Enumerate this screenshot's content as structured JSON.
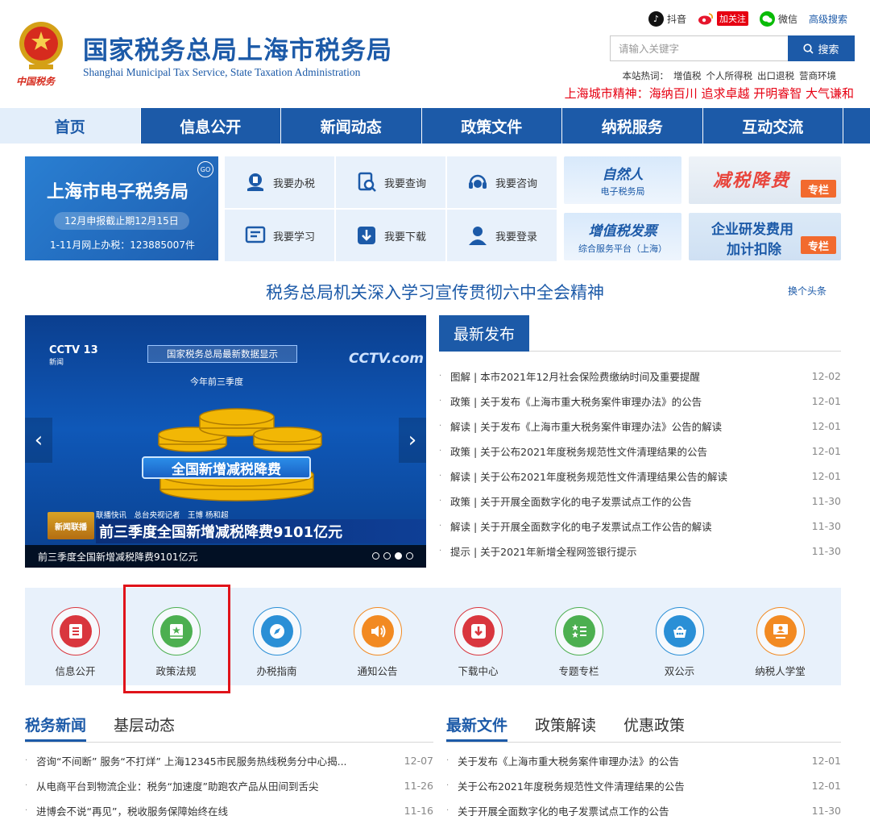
{
  "header": {
    "title": "国家税务总局上海市税务局",
    "subtitle": "Shanghai Municipal Tax Service, State Taxation Administration",
    "emblem_text": "中国税务",
    "top_links": {
      "douyin": "抖音",
      "weibo_follow": "加关注",
      "wechat": "微信",
      "advanced_search": "高级搜索"
    },
    "search": {
      "placeholder": "请输入关键字",
      "button": "搜索"
    },
    "hot_words_label": "本站热词：",
    "hot_words": [
      "增值税",
      "个人所得税",
      "出口退税",
      "营商环境"
    ],
    "spirit_label": "上海城市精神：",
    "spirit_text": "海纳百川 追求卓越 开明睿智 大气谦和"
  },
  "nav": [
    "首页",
    "信息公开",
    "新闻动态",
    "政策文件",
    "纳税服务",
    "互动交流"
  ],
  "etax": {
    "title": "上海市电子税务局",
    "go_label": "GO",
    "deadline": "12月申报截止期12月15日",
    "count": "1-11月网上办税：123885007件"
  },
  "actions": [
    "我要办税",
    "我要查询",
    "我要咨询",
    "我要学习",
    "我要下载",
    "我要登录"
  ],
  "promos": {
    "natural_title": "自然人",
    "natural_sub": "电子税务局",
    "cut_title": "减税降费",
    "cut_tag": "专栏",
    "vat_title": "增值税发票",
    "vat_sub": "综合服务平台（上海）",
    "rd_line1": "企业研发费用",
    "rd_line2": "加计扣除",
    "rd_tag": "专栏"
  },
  "headline": {
    "text": "税务总局机关深入学习宣传贯彻六中全会精神",
    "change": "换个头条"
  },
  "carousel": {
    "channel": "CCTV 13",
    "channel_sub": "新闻",
    "watermark": "CCTV.com",
    "banner": "国家税务总局最新数据显示",
    "sub": "今年前三季度",
    "big_label": "全国新增减税降费",
    "strip_small": "联播快讯　总台央视记者　王博 杨和超",
    "strip": "前三季度全国新增减税降费9101亿元",
    "logo": "新闻联播",
    "caption": "前三季度全国新增减税降费9101亿元",
    "active_dot": 2,
    "dot_count": 4
  },
  "latest": {
    "tab": "最新发布",
    "items": [
      {
        "text": "图解 | 本市2021年12月社会保险费缴纳时间及重要提醒",
        "date": "12-02"
      },
      {
        "text": "政策 | 关于发布《上海市重大税务案件审理办法》的公告",
        "date": "12-01"
      },
      {
        "text": "解读 | 关于发布《上海市重大税务案件审理办法》公告的解读",
        "date": "12-01"
      },
      {
        "text": "政策 | 关于公布2021年度税务规范性文件清理结果的公告",
        "date": "12-01"
      },
      {
        "text": "解读 | 关于公布2021年度税务规范性文件清理结果公告的解读",
        "date": "12-01"
      },
      {
        "text": "政策 | 关于开展全面数字化的电子发票试点工作的公告",
        "date": "11-30"
      },
      {
        "text": "解读 | 关于开展全面数字化的电子发票试点工作公告的解读",
        "date": "11-30"
      },
      {
        "text": "提示 | 关于2021年新增全程网签银行提示",
        "date": "11-30"
      }
    ]
  },
  "services": [
    {
      "label": "信息公开",
      "icon": "list-icon",
      "color": "#d9363e"
    },
    {
      "label": "政策法规",
      "icon": "book-icon",
      "color": "#4caf50"
    },
    {
      "label": "办税指南",
      "icon": "compass-icon",
      "color": "#2a8fd6"
    },
    {
      "label": "通知公告",
      "icon": "speaker-icon",
      "color": "#f28a22"
    },
    {
      "label": "下载中心",
      "icon": "download-icon",
      "color": "#d9363e"
    },
    {
      "label": "专题专栏",
      "icon": "stars-icon",
      "color": "#4caf50"
    },
    {
      "label": "双公示",
      "icon": "basket-icon",
      "color": "#2a8fd6"
    },
    {
      "label": "纳税人学堂",
      "icon": "classroom-icon",
      "color": "#f28a22"
    }
  ],
  "tax_news": {
    "tabs": [
      "税务新闻",
      "基层动态"
    ],
    "items": [
      {
        "text": "咨询“不间断” 服务“不打烊” 上海12345市民服务热线税务分中心揭...",
        "date": "12-07"
      },
      {
        "text": "从电商平台到物流企业：税务“加速度”助跑农产品从田间到舌尖",
        "date": "11-26"
      },
      {
        "text": "进博会不说“再见”，税收服务保障始终在线",
        "date": "11-16"
      }
    ]
  },
  "files": {
    "tabs": [
      "最新文件",
      "政策解读",
      "优惠政策"
    ],
    "items": [
      {
        "text": "关于发布《上海市重大税务案件审理办法》的公告",
        "date": "12-01"
      },
      {
        "text": "关于公布2021年度税务规范性文件清理结果的公告",
        "date": "12-01"
      },
      {
        "text": "关于开展全面数字化的电子发票试点工作的公告",
        "date": "11-30"
      }
    ]
  },
  "colors": {
    "brand": "#1c5aa8",
    "accent_red": "#e60012",
    "panel_bg": "#e8f1fb",
    "highlight": "#e0131a"
  }
}
